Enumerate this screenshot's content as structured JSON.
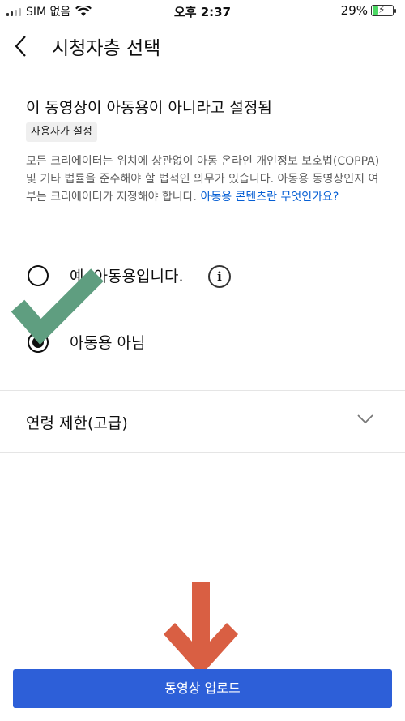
{
  "status_bar": {
    "carrier": "SIM 없음",
    "time": "오후 2:37",
    "battery": "29%",
    "battery_level": 0.29
  },
  "header": {
    "title": "시청자층 선택"
  },
  "audience": {
    "status_title": "이 동영상이 아동용이 아니라고 설정됨",
    "chip": "사용자가 설정",
    "description": "모든 크리에이터는 위치에 상관없이 아동 온라인 개인정보 보호법(COPPA) 및 기타 법률을 준수해야 할 법적인 의무가 있습니다. 아동용 동영상인지 여부는 크리에이터가 지정해야 합니다. ",
    "link": "아동용 콘텐츠란 무엇인가요?",
    "options": [
      {
        "label": "예, 아동용입니다.",
        "checked": false
      },
      {
        "label": "아동용 아님",
        "checked": true
      }
    ]
  },
  "age_restriction": {
    "label": "연령 제한(고급)"
  },
  "upload_button": "동영상 업로드",
  "colors": {
    "checkmark": "#5f9e80",
    "arrow": "#d95f43",
    "button": "#2d5fd8",
    "link": "#065fd4"
  }
}
